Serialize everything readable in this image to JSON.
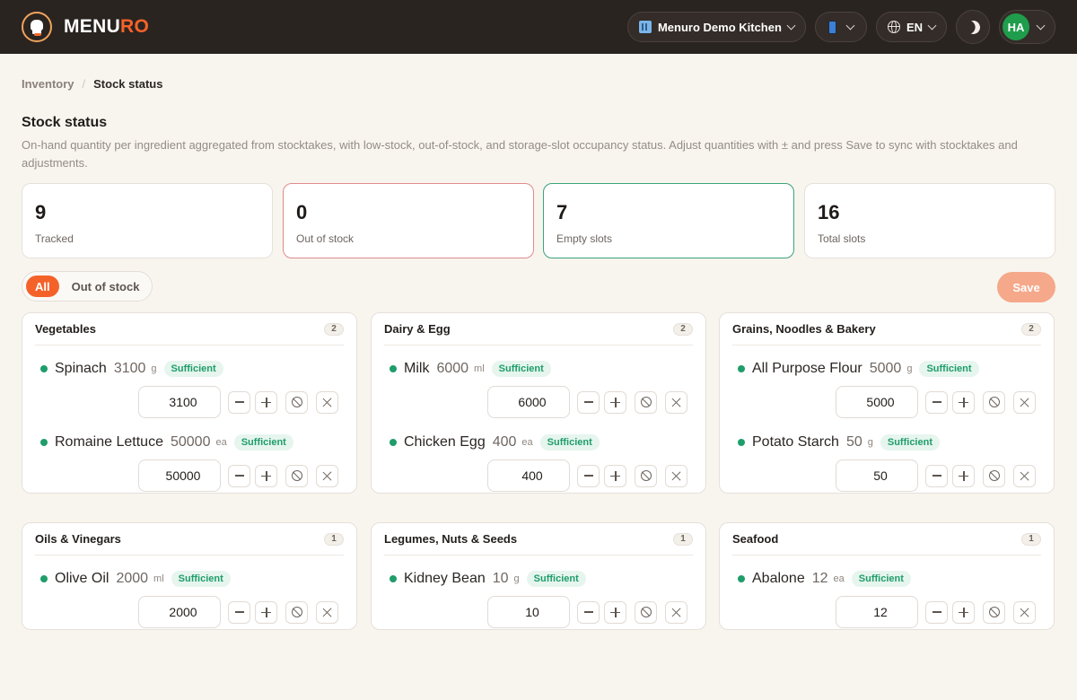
{
  "app": {
    "brand_main": "MENU",
    "brand_accent": "RO"
  },
  "header": {
    "kitchen": "Menuro Demo Kitchen",
    "language": "EN",
    "user_initials": "HA"
  },
  "breadcrumb": {
    "parent": "Inventory",
    "separator": "/",
    "current": "Stock status"
  },
  "page": {
    "title": "Stock status",
    "description": "On-hand quantity per ingredient aggregated from stocktakes, with low-stock, out-of-stock, and storage-slot occupancy status. Adjust quantities with ± and press Save to sync with stocktakes and adjustments."
  },
  "stats": [
    {
      "value": "9",
      "label": "Tracked"
    },
    {
      "value": "0",
      "label": "Out of stock"
    },
    {
      "value": "7",
      "label": "Empty slots"
    },
    {
      "value": "16",
      "label": "Total slots"
    }
  ],
  "filters": {
    "all": "All",
    "out_of_stock": "Out of stock"
  },
  "save_label": "Save",
  "colors": {
    "accent": "#f4622a",
    "sufficient": "#1f9d6a",
    "topbar": "#2a2420"
  },
  "categories": [
    {
      "title": "Vegetables",
      "count": "2",
      "items": [
        {
          "name": "Spinach",
          "qty": "3100",
          "unit": "g",
          "status": "Sufficient",
          "value": "3100"
        },
        {
          "name": "Romaine Lettuce",
          "qty": "50000",
          "unit": "ea",
          "status": "Sufficient",
          "value": "50000"
        }
      ]
    },
    {
      "title": "Dairy & Egg",
      "count": "2",
      "items": [
        {
          "name": "Milk",
          "qty": "6000",
          "unit": "ml",
          "status": "Sufficient",
          "value": "6000"
        },
        {
          "name": "Chicken Egg",
          "qty": "400",
          "unit": "ea",
          "status": "Sufficient",
          "value": "400"
        }
      ]
    },
    {
      "title": "Grains, Noodles & Bakery",
      "count": "2",
      "items": [
        {
          "name": "All Purpose Flour",
          "qty": "5000",
          "unit": "g",
          "status": "Sufficient",
          "value": "5000"
        },
        {
          "name": "Potato Starch",
          "qty": "50",
          "unit": "g",
          "status": "Sufficient",
          "value": "50"
        }
      ]
    },
    {
      "title": "Oils & Vinegars",
      "count": "1",
      "items": [
        {
          "name": "Olive Oil",
          "qty": "2000",
          "unit": "ml",
          "status": "Sufficient",
          "value": "2000"
        }
      ]
    },
    {
      "title": "Legumes, Nuts & Seeds",
      "count": "1",
      "items": [
        {
          "name": "Kidney Bean",
          "qty": "10",
          "unit": "g",
          "status": "Sufficient",
          "value": "10"
        }
      ]
    },
    {
      "title": "Seafood",
      "count": "1",
      "items": [
        {
          "name": "Abalone",
          "qty": "12",
          "unit": "ea",
          "status": "Sufficient",
          "value": "12"
        }
      ]
    }
  ]
}
